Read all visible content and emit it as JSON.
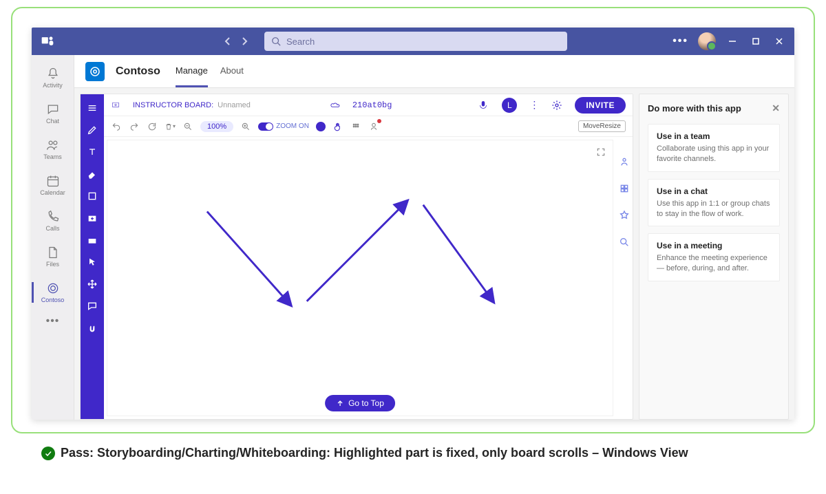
{
  "titlebar": {
    "search_placeholder": "Search"
  },
  "leftrail": {
    "activity": "Activity",
    "chat": "Chat",
    "teams": "Teams",
    "calendar": "Calendar",
    "calls": "Calls",
    "files": "Files",
    "contoso": "Contoso"
  },
  "app": {
    "name": "Contoso",
    "tab_manage": "Manage",
    "tab_about": "About"
  },
  "board": {
    "board_label": "INSTRUCTOR BOARD:",
    "board_name": "Unnamed",
    "code": "210at0bg",
    "avatar_initial": "L",
    "invite": "INVITE",
    "zoom_pct": "100%",
    "zoom_label": "ZOOM ON",
    "move_resize": "MoveResize",
    "go_top": "Go to Top"
  },
  "sidepanel": {
    "title": "Do more with this app",
    "cards": [
      {
        "title": "Use in a team",
        "desc": "Collaborate using this app in your favorite channels."
      },
      {
        "title": "Use in a chat",
        "desc": "Use this app in 1:1 or group chats to stay in the flow of work."
      },
      {
        "title": "Use in a meeting",
        "desc": "Enhance the meeting experience — before, during, and after."
      }
    ]
  },
  "caption": "Pass: Storyboarding/Charting/Whiteboarding: Highlighted part is fixed, only board scrolls – Windows View"
}
